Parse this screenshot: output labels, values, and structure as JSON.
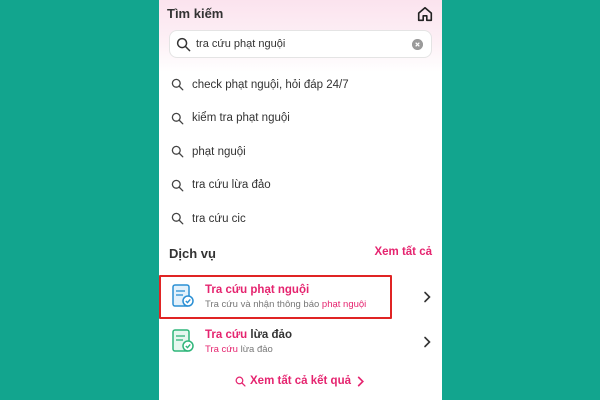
{
  "header": {
    "title": "Tìm kiếm",
    "home_icon": "home-icon"
  },
  "search": {
    "value": "tra cứu phạt nguội",
    "icon": "search-icon",
    "clear_icon": "clear-icon"
  },
  "suggestions": [
    {
      "label": "check phạt nguội, hỏi đáp 24/7"
    },
    {
      "label": "kiểm tra phạt nguội"
    },
    {
      "label": "phạt nguội"
    },
    {
      "label": "tra cứu lừa đảo"
    },
    {
      "label": "tra cứu cic"
    }
  ],
  "services_section": {
    "title": "Dịch vụ",
    "see_all": "Xem tất cả"
  },
  "services": [
    {
      "title_highlight": "Tra cứu phạt nguội",
      "title_rest": "",
      "sub_plain": "Tra cứu và nhận thông báo ",
      "sub_highlight": "phạt nguội",
      "icon": "document-check-icon",
      "highlighted": true
    },
    {
      "title_highlight": "Tra cứu",
      "title_rest": " lừa đảo",
      "sub_plain": "",
      "sub_highlight": "Tra cứu",
      "sub_rest": " lừa đảo",
      "icon": "document-shield-icon",
      "highlighted": false
    }
  ],
  "footer": {
    "see_all_results": "Xem tất cả kết quả"
  },
  "colors": {
    "background": "#12a58e",
    "accent": "#e5246f",
    "highlight_box": "#e02424",
    "icon_blue": "#2a8fd4",
    "icon_green": "#2fb67a"
  }
}
